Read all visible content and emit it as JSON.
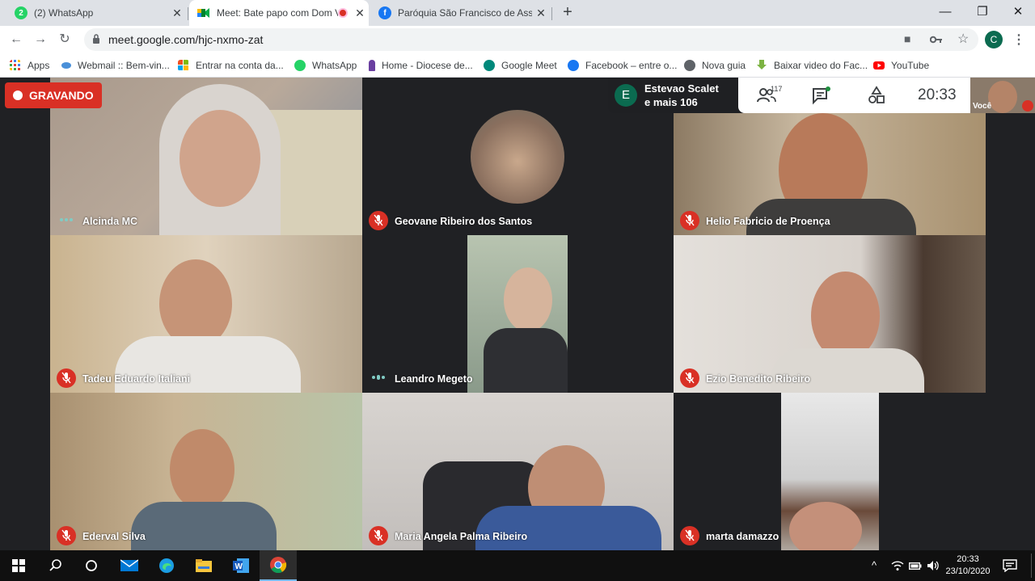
{
  "tabs": [
    {
      "title": "(2) WhatsApp",
      "icon": "whatsapp-icon",
      "color": "#25d366",
      "badge": "2"
    },
    {
      "title": "Meet: Bate papo com Dom V",
      "icon": "google-meet-icon",
      "color": "#00897b",
      "active": true
    },
    {
      "title": "Paróquia São Francisco de Assis",
      "icon": "facebook-icon",
      "color": "#1877f2"
    }
  ],
  "address_bar": {
    "url": "meet.google.com/hjc-nxmo-zat"
  },
  "profile_initial": "C",
  "bookmarks": [
    {
      "label": "Apps",
      "icon": "apps-grid-icon"
    },
    {
      "label": "Webmail :: Bem-vin...",
      "icon": "webmail-icon"
    },
    {
      "label": "Entrar na conta da...",
      "icon": "microsoft-icon"
    },
    {
      "label": "WhatsApp",
      "icon": "whatsapp-icon"
    },
    {
      "label": "Home - Diocese de...",
      "icon": "diocese-icon"
    },
    {
      "label": "Google Meet",
      "icon": "google-meet-icon"
    },
    {
      "label": "Facebook – entre o...",
      "icon": "facebook-icon"
    },
    {
      "label": "Nova guia",
      "icon": "globe-icon"
    },
    {
      "label": "Baixar video do Fac...",
      "icon": "download-icon"
    },
    {
      "label": "YouTube",
      "icon": "youtube-icon"
    }
  ],
  "meet": {
    "recording_label": "GRAVANDO",
    "presenter": {
      "initial": "E",
      "line1": "Estevao Scalet",
      "line2": "e mais 106"
    },
    "participant_count": "117",
    "clock": "20:33",
    "self_label": "Você",
    "tiles": [
      {
        "name": "Alcinda MC",
        "mic": "speaking",
        "bg": "#9c8a78"
      },
      {
        "name": "Geovane Ribeiro dos Santos",
        "mic": "muted",
        "bg": "#202124"
      },
      {
        "name": "Helio Fabricio de Proença",
        "mic": "muted",
        "bg": "#8c7a63"
      },
      {
        "name": "Tadeu Eduardo Italiani",
        "mic": "muted",
        "bg": "#b8a890"
      },
      {
        "name": "Leandro Megeto",
        "mic": "speaking",
        "bg": "#202124"
      },
      {
        "name": "Ezio Benedito Ribeiro",
        "mic": "muted",
        "bg": "#bfb5a8"
      },
      {
        "name": "Ederval Silva",
        "mic": "muted",
        "bg": "#b09c80"
      },
      {
        "name": "Maria Angela Palma Ribeiro",
        "mic": "muted",
        "bg": "#c8c3c0"
      },
      {
        "name": "marta damazzo",
        "mic": "muted",
        "bg": "#202124"
      }
    ]
  },
  "taskbar": {
    "time": "20:33",
    "date": "23/10/2020"
  },
  "colors": {
    "accent_red": "#d93025",
    "meet_bg": "#202124",
    "chrome_tabstrip": "#dee1e6"
  }
}
